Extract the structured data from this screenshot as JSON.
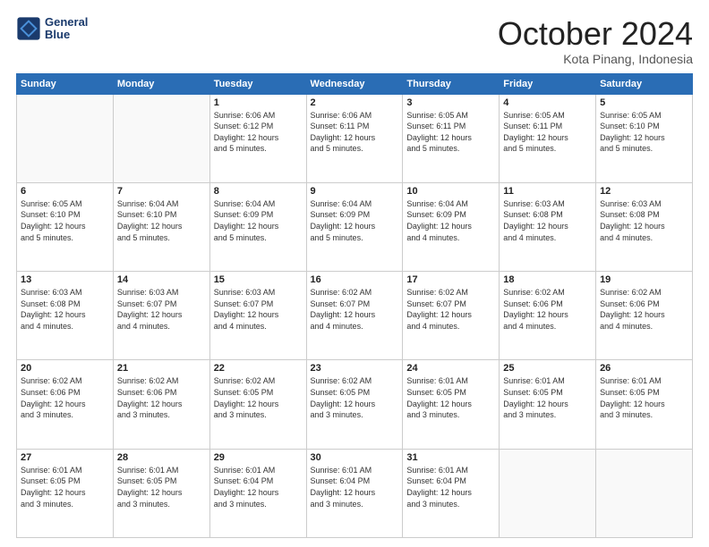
{
  "logo": {
    "line1": "General",
    "line2": "Blue"
  },
  "header": {
    "month": "October 2024",
    "location": "Kota Pinang, Indonesia"
  },
  "weekdays": [
    "Sunday",
    "Monday",
    "Tuesday",
    "Wednesday",
    "Thursday",
    "Friday",
    "Saturday"
  ],
  "weeks": [
    [
      {
        "day": "",
        "info": ""
      },
      {
        "day": "",
        "info": ""
      },
      {
        "day": "1",
        "info": "Sunrise: 6:06 AM\nSunset: 6:12 PM\nDaylight: 12 hours\nand 5 minutes."
      },
      {
        "day": "2",
        "info": "Sunrise: 6:06 AM\nSunset: 6:11 PM\nDaylight: 12 hours\nand 5 minutes."
      },
      {
        "day": "3",
        "info": "Sunrise: 6:05 AM\nSunset: 6:11 PM\nDaylight: 12 hours\nand 5 minutes."
      },
      {
        "day": "4",
        "info": "Sunrise: 6:05 AM\nSunset: 6:11 PM\nDaylight: 12 hours\nand 5 minutes."
      },
      {
        "day": "5",
        "info": "Sunrise: 6:05 AM\nSunset: 6:10 PM\nDaylight: 12 hours\nand 5 minutes."
      }
    ],
    [
      {
        "day": "6",
        "info": "Sunrise: 6:05 AM\nSunset: 6:10 PM\nDaylight: 12 hours\nand 5 minutes."
      },
      {
        "day": "7",
        "info": "Sunrise: 6:04 AM\nSunset: 6:10 PM\nDaylight: 12 hours\nand 5 minutes."
      },
      {
        "day": "8",
        "info": "Sunrise: 6:04 AM\nSunset: 6:09 PM\nDaylight: 12 hours\nand 5 minutes."
      },
      {
        "day": "9",
        "info": "Sunrise: 6:04 AM\nSunset: 6:09 PM\nDaylight: 12 hours\nand 5 minutes."
      },
      {
        "day": "10",
        "info": "Sunrise: 6:04 AM\nSunset: 6:09 PM\nDaylight: 12 hours\nand 4 minutes."
      },
      {
        "day": "11",
        "info": "Sunrise: 6:03 AM\nSunset: 6:08 PM\nDaylight: 12 hours\nand 4 minutes."
      },
      {
        "day": "12",
        "info": "Sunrise: 6:03 AM\nSunset: 6:08 PM\nDaylight: 12 hours\nand 4 minutes."
      }
    ],
    [
      {
        "day": "13",
        "info": "Sunrise: 6:03 AM\nSunset: 6:08 PM\nDaylight: 12 hours\nand 4 minutes."
      },
      {
        "day": "14",
        "info": "Sunrise: 6:03 AM\nSunset: 6:07 PM\nDaylight: 12 hours\nand 4 minutes."
      },
      {
        "day": "15",
        "info": "Sunrise: 6:03 AM\nSunset: 6:07 PM\nDaylight: 12 hours\nand 4 minutes."
      },
      {
        "day": "16",
        "info": "Sunrise: 6:02 AM\nSunset: 6:07 PM\nDaylight: 12 hours\nand 4 minutes."
      },
      {
        "day": "17",
        "info": "Sunrise: 6:02 AM\nSunset: 6:07 PM\nDaylight: 12 hours\nand 4 minutes."
      },
      {
        "day": "18",
        "info": "Sunrise: 6:02 AM\nSunset: 6:06 PM\nDaylight: 12 hours\nand 4 minutes."
      },
      {
        "day": "19",
        "info": "Sunrise: 6:02 AM\nSunset: 6:06 PM\nDaylight: 12 hours\nand 4 minutes."
      }
    ],
    [
      {
        "day": "20",
        "info": "Sunrise: 6:02 AM\nSunset: 6:06 PM\nDaylight: 12 hours\nand 3 minutes."
      },
      {
        "day": "21",
        "info": "Sunrise: 6:02 AM\nSunset: 6:06 PM\nDaylight: 12 hours\nand 3 minutes."
      },
      {
        "day": "22",
        "info": "Sunrise: 6:02 AM\nSunset: 6:05 PM\nDaylight: 12 hours\nand 3 minutes."
      },
      {
        "day": "23",
        "info": "Sunrise: 6:02 AM\nSunset: 6:05 PM\nDaylight: 12 hours\nand 3 minutes."
      },
      {
        "day": "24",
        "info": "Sunrise: 6:01 AM\nSunset: 6:05 PM\nDaylight: 12 hours\nand 3 minutes."
      },
      {
        "day": "25",
        "info": "Sunrise: 6:01 AM\nSunset: 6:05 PM\nDaylight: 12 hours\nand 3 minutes."
      },
      {
        "day": "26",
        "info": "Sunrise: 6:01 AM\nSunset: 6:05 PM\nDaylight: 12 hours\nand 3 minutes."
      }
    ],
    [
      {
        "day": "27",
        "info": "Sunrise: 6:01 AM\nSunset: 6:05 PM\nDaylight: 12 hours\nand 3 minutes."
      },
      {
        "day": "28",
        "info": "Sunrise: 6:01 AM\nSunset: 6:05 PM\nDaylight: 12 hours\nand 3 minutes."
      },
      {
        "day": "29",
        "info": "Sunrise: 6:01 AM\nSunset: 6:04 PM\nDaylight: 12 hours\nand 3 minutes."
      },
      {
        "day": "30",
        "info": "Sunrise: 6:01 AM\nSunset: 6:04 PM\nDaylight: 12 hours\nand 3 minutes."
      },
      {
        "day": "31",
        "info": "Sunrise: 6:01 AM\nSunset: 6:04 PM\nDaylight: 12 hours\nand 3 minutes."
      },
      {
        "day": "",
        "info": ""
      },
      {
        "day": "",
        "info": ""
      }
    ]
  ]
}
